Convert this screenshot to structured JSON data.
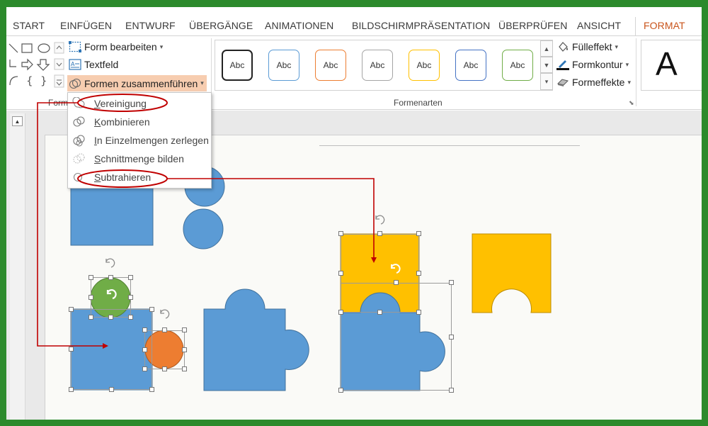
{
  "tabs": [
    {
      "label": "START"
    },
    {
      "label": "EINFÜGEN"
    },
    {
      "label": "ENTWURF"
    },
    {
      "label": "ÜBERGÄNGE"
    },
    {
      "label": "ANIMATIONEN"
    },
    {
      "label": "BILDSCHIRMPRÄSENTATION"
    },
    {
      "label": "ÜBERPRÜFEN"
    },
    {
      "label": "ANSICHT"
    },
    {
      "label": "FORMAT"
    }
  ],
  "active_tab": "FORMAT",
  "ribbon": {
    "insert_shapes": {
      "group_label": "Form",
      "edit_shape": "Form bearbeiten",
      "text_box": "Textfeld",
      "merge_shapes": "Formen zusammenführen"
    },
    "shape_styles": {
      "group_label": "Formenarten",
      "style_label": "Abc",
      "styles": [
        {
          "border": "#222222",
          "width": 2
        },
        {
          "border": "#5b9bd5",
          "width": 1
        },
        {
          "border": "#ed7d31",
          "width": 1
        },
        {
          "border": "#a5a5a5",
          "width": 1
        },
        {
          "border": "#ffc000",
          "width": 1
        },
        {
          "border": "#4472c4",
          "width": 1
        },
        {
          "border": "#70ad47",
          "width": 1
        }
      ],
      "fill": "Fülleffekt",
      "outline": "Formkontur",
      "effects": "Formeffekte"
    },
    "wordart_letter": "A"
  },
  "merge_menu": {
    "items": [
      {
        "label": "Vereinigung",
        "highlighted": false,
        "circled": true
      },
      {
        "label": "Kombinieren",
        "highlighted": false,
        "circled": false
      },
      {
        "label": "In Einzelmengen zerlegen",
        "highlighted": false,
        "circled": false
      },
      {
        "label": "Schnittmenge bilden",
        "highlighted": false,
        "circled": false
      },
      {
        "label": "Subtrahieren",
        "highlighted": false,
        "circled": true
      }
    ]
  },
  "colors": {
    "accent": "#c9541b",
    "frame": "#2c8a2c",
    "blue_shape": "#5b9bd5",
    "green_shape": "#70ad47",
    "orange_shape": "#ed7d31",
    "yellow_shape": "#ffc000",
    "annotation": "#c00000",
    "menu_highlight": "#f7cdb0"
  }
}
